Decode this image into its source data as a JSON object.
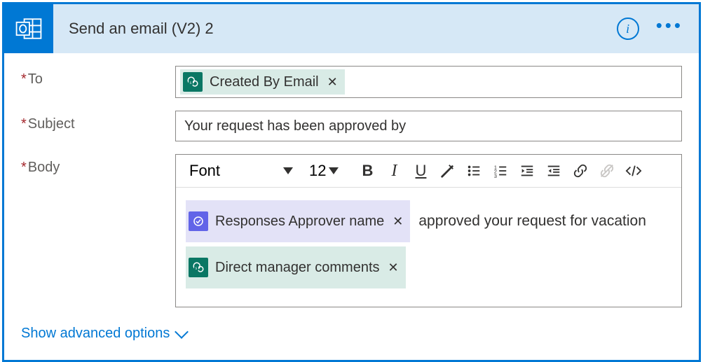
{
  "header": {
    "title": "Send an email (V2) 2",
    "info_label": "i",
    "more_label": "..."
  },
  "fields": {
    "to": {
      "label": "To",
      "required": true
    },
    "subject": {
      "label": "Subject",
      "required": true,
      "value": "Your request has been approved by"
    },
    "body": {
      "label": "Body",
      "required": true
    }
  },
  "to_tokens": [
    {
      "label": "Created By Email",
      "source": "sharepoint"
    }
  ],
  "body_content": {
    "line1_suffix": "approved your request for vacation",
    "tokens": {
      "approver": {
        "label": "Responses Approver name",
        "source": "approvals"
      },
      "comments": {
        "label": "Direct manager comments",
        "source": "sharepoint"
      }
    }
  },
  "rte": {
    "font": "Font",
    "size": "12"
  },
  "icon_names": {
    "bold": "B",
    "italic": "I",
    "underline": "U"
  },
  "advanced_link": "Show advanced options"
}
